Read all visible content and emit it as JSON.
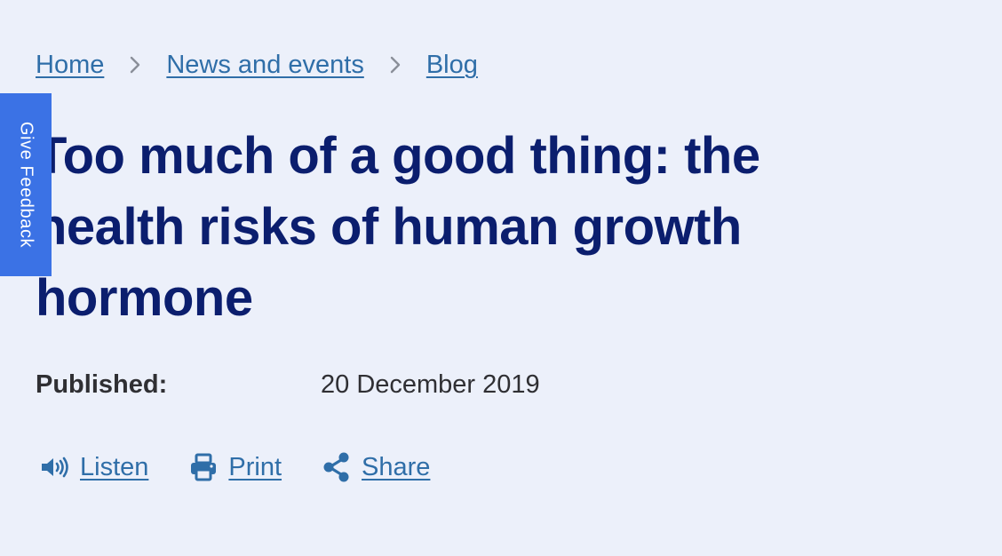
{
  "breadcrumb": {
    "items": [
      {
        "label": "Home"
      },
      {
        "label": "News and events"
      },
      {
        "label": "Blog"
      }
    ],
    "separator_icon": "chevron-right-icon"
  },
  "feedback_tab": {
    "label": "Give Feedback",
    "color": "#3b72e5"
  },
  "article": {
    "title": "Too much of a good thing: the health risks of human growth hormone",
    "published_label": "Published:",
    "published_date": "20 December 2019"
  },
  "actions": {
    "listen": {
      "label": "Listen",
      "icon": "speaker-icon"
    },
    "print": {
      "label": "Print",
      "icon": "printer-icon"
    },
    "share": {
      "label": "Share",
      "icon": "share-icon"
    }
  },
  "colors": {
    "background": "#ecf0fa",
    "link": "#2f6ea8",
    "title": "#0b1e6e",
    "text": "#2f2f33"
  }
}
